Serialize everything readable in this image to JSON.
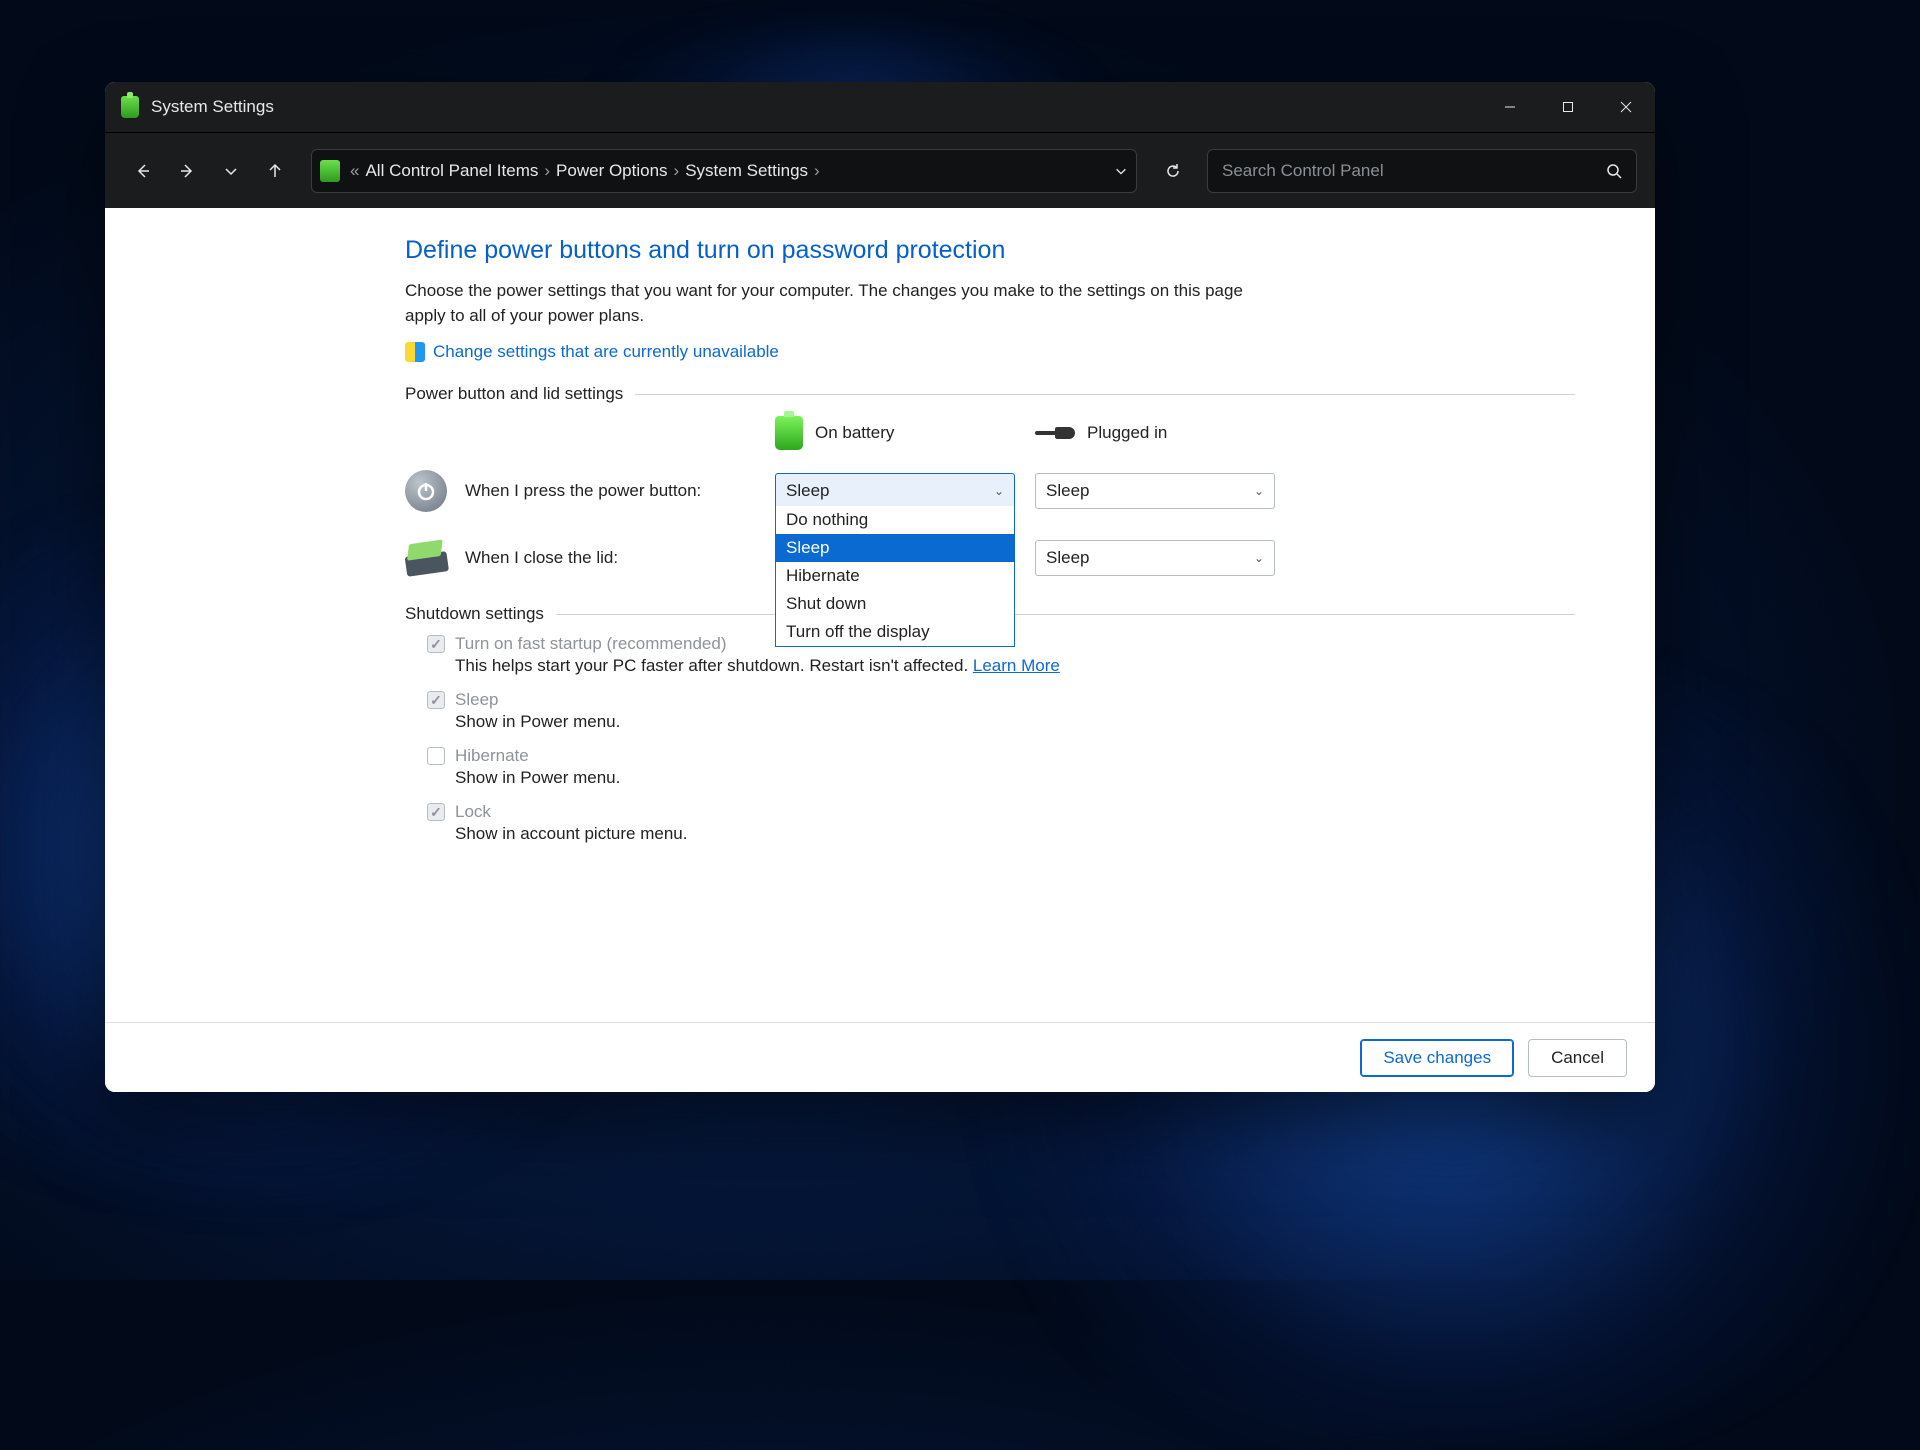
{
  "window": {
    "title": "System Settings"
  },
  "breadcrumb": {
    "prefix": "«",
    "items": [
      "All Control Panel Items",
      "Power Options",
      "System Settings"
    ]
  },
  "search": {
    "placeholder": "Search Control Panel"
  },
  "page": {
    "heading": "Define power buttons and turn on password protection",
    "description": "Choose the power settings that you want for your computer. The changes you make to the settings on this page apply to all of your power plans.",
    "change_link": "Change settings that are currently unavailable",
    "section_power": "Power button and lid settings",
    "section_shutdown": "Shutdown settings",
    "col_battery": "On battery",
    "col_plugged": "Plugged in",
    "row_power_label": "When I press the power button:",
    "row_lid_label": "When I close the lid:",
    "power_battery_value": "Sleep",
    "power_plugged_value": "Sleep",
    "lid_plugged_value": "Sleep",
    "dropdown_options": [
      "Do nothing",
      "Sleep",
      "Hibernate",
      "Shut down",
      "Turn off the display"
    ],
    "dropdown_selected_index": 1
  },
  "shutdown": {
    "items": [
      {
        "label": "Turn on fast startup (recommended)",
        "checked": true,
        "desc": "This helps start your PC faster after shutdown. Restart isn't affected. ",
        "desc_link": "Learn More"
      },
      {
        "label": "Sleep",
        "checked": true,
        "desc": "Show in Power menu."
      },
      {
        "label": "Hibernate",
        "checked": false,
        "desc": "Show in Power menu."
      },
      {
        "label": "Lock",
        "checked": true,
        "desc": "Show in account picture menu."
      }
    ]
  },
  "footer": {
    "save": "Save changes",
    "cancel": "Cancel"
  }
}
